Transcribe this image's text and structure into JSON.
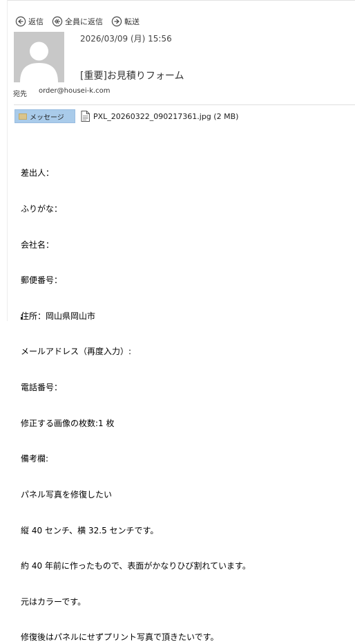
{
  "toolbar": {
    "reply_label": "返信",
    "reply_all_label": "全員に返信",
    "forward_label": "転送"
  },
  "message": {
    "date": "2026/03/09 (月) 15:56",
    "subject": "[重要]お見積りフォーム",
    "to_label": "宛先",
    "to_address": "order@housei-k.com"
  },
  "tabs": {
    "message_tab_label": "メッセージ",
    "attachment_label": "PXL_20260322_090217361.jpg (2 MB)"
  },
  "body": {
    "lines": [
      "差出人：",
      "ふりがな：",
      "会社名：",
      "郵便番号：",
      "住所：岡山県岡山市",
      "メールアドレス（再度入力）:",
      "電話番号：",
      "修正する画像の枚数:1 枚",
      "備考欄:",
      "パネル写真を修復したい",
      "縦 40 センチ、横 32.5 センチです。",
      "約 40 年前に作ったもので、表面がかなりひび割れています。",
      "元はカラーです。",
      "修復後はパネルにせずプリント写真で頂きたいです。"
    ]
  },
  "icons": {
    "reply": "reply-icon",
    "reply_all": "reply-all-icon",
    "forward": "forward-icon",
    "avatar": "avatar-silhouette",
    "message_tab": "envelope-icon",
    "attachment": "document-icon"
  }
}
